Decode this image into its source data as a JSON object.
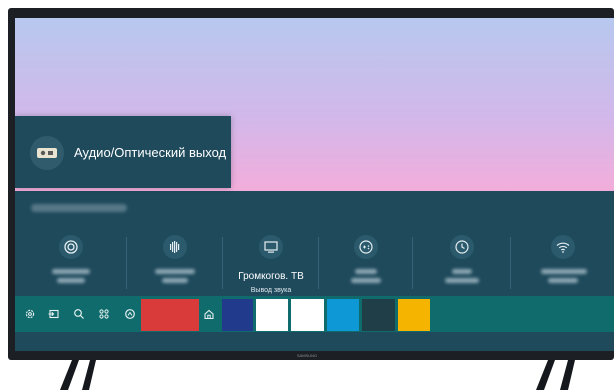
{
  "popup": {
    "label": "Аудио/Оптический выход",
    "icon": "optical-audio-icon"
  },
  "quick_settings": {
    "tiles": [
      {
        "icon": "picture-mode-icon"
      },
      {
        "icon": "sound-mode-icon"
      },
      {
        "icon": "tv-icon",
        "label": "Громкогов. ТВ",
        "sublabel": "Вывод звука"
      },
      {
        "icon": "game-mode-icon"
      },
      {
        "icon": "sleep-timer-icon"
      },
      {
        "icon": "wifi-icon"
      }
    ]
  },
  "taskbar": {
    "icons": [
      "settings-icon",
      "source-icon",
      "search-icon",
      "apps-icon",
      "ambient-icon",
      "home-icon"
    ],
    "app_colors": [
      "#d93a3a",
      "#223a8c",
      "#ffffff",
      "#ffffff",
      "#0e99d6",
      "#1f3e47",
      "#f5b400"
    ]
  },
  "brand": "SAMSUNG",
  "colors": {
    "panel": "#1e4a5c",
    "taskbar": "#0f6b6c",
    "bezel": "#1c1f24"
  }
}
